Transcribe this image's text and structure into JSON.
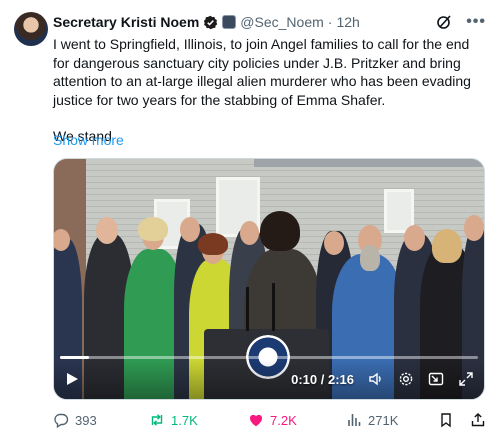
{
  "author": {
    "name": "Secretary Kristi Noem",
    "handle": "@Sec_Noem",
    "separator": "·",
    "time": "12h"
  },
  "post": {
    "paragraph_1": "I went to Springfield, Illinois, to join Angel families to call for the end for dangerous sanctuary city policies under J.B. Pritzker and bring attention to an at-large illegal alien murderer who has been evading justice for two years for the stabbing of Emma Shafer.",
    "paragraph_2": "We stand",
    "show_more": "Show more"
  },
  "video": {
    "current_time": "0:10",
    "duration": "2:16",
    "time_separator": " / ",
    "progress_fraction": 0.07
  },
  "actions": {
    "replies": "393",
    "reposts": "1.7K",
    "likes": "7.2K",
    "views": "271K"
  },
  "colors": {
    "accent": "#1d9bf0",
    "repost": "#00ba7c",
    "like": "#f91880",
    "muted": "#536471"
  },
  "icons": [
    "verified-badge-icon",
    "grok-icon",
    "more-icon",
    "play-icon",
    "volume-icon",
    "settings-icon",
    "pip-icon",
    "fullscreen-icon",
    "reply-icon",
    "repost-icon",
    "like-icon",
    "views-icon",
    "bookmark-icon",
    "share-icon"
  ]
}
